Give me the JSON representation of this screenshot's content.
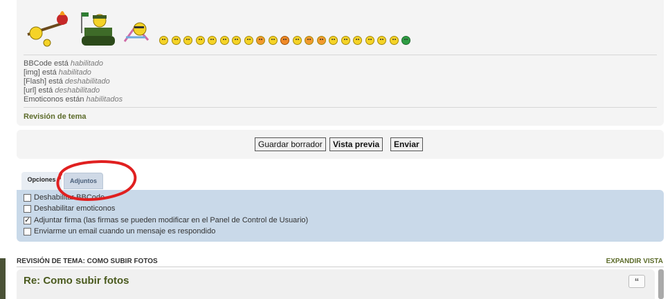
{
  "info": {
    "bbcode": {
      "label": "BBCode está",
      "status": "habilitado"
    },
    "img": {
      "label": "[img] está",
      "status": "habilitado"
    },
    "flash": {
      "label": "[Flash] está",
      "status": "deshabilitado"
    },
    "url": {
      "label": "[url] está",
      "status": "deshabilitado"
    },
    "emoticons": {
      "label": "Emoticonos están",
      "status": "habilitados"
    }
  },
  "review_topic_link": "Revisión de tema",
  "buttons": {
    "save_draft": "Guardar borrador",
    "preview": "Vista previa",
    "submit": "Enviar"
  },
  "tabs": [
    {
      "label": "Opciones",
      "active": true
    },
    {
      "label": "Adjuntos",
      "active": false
    }
  ],
  "options": [
    {
      "label": "Deshabilitar BBCode",
      "checked": false
    },
    {
      "label": "Deshabilitar emoticonos",
      "checked": false
    },
    {
      "label": "Adjuntar firma (las firmas se pueden modificar en el Panel de Control de Usuario)",
      "checked": true
    },
    {
      "label": "Enviarme un email cuando un mensaje es respondido",
      "checked": false
    }
  ],
  "review": {
    "heading": "REVISIÓN DE TEMA: COMO SUBIR FOTOS",
    "expand": "EXPANDIR VISTA",
    "post_title": "Re: Como subir fotos",
    "quote_icon": "quote-icon"
  },
  "colors": {
    "accent_green": "#5c6b2a",
    "options_bg": "#c9d9e9",
    "annotation_red": "#e02020"
  },
  "smilies": [
    "smile",
    "smile",
    "sad",
    "surprised",
    "eek",
    "confused",
    "cool",
    "lol",
    "mad",
    "razz",
    "red",
    "rolleyes",
    "evil",
    "twisted",
    "wink",
    "exclaim",
    "question",
    "idea",
    "arrow",
    "neutral",
    "mrgreen"
  ]
}
